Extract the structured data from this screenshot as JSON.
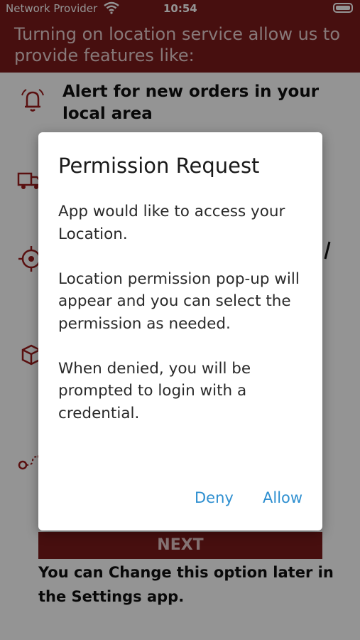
{
  "status_bar": {
    "carrier": "Network Provider",
    "time": "10:54",
    "wifi_icon": "wifi-icon",
    "battery_icon": "battery-full-icon"
  },
  "header": {
    "text": "Turning on location service allow us to provide features like:"
  },
  "features": [
    {
      "icon": "bell-icon",
      "label": "Alert for new orders in your local area"
    },
    {
      "icon": "delivery-truck-icon",
      "label": ""
    },
    {
      "icon": "location-target-icon",
      "label": ""
    },
    {
      "icon": "package-icon",
      "label": ""
    },
    {
      "icon": "route-icon",
      "label": ""
    }
  ],
  "next_button": {
    "label": "NEXT"
  },
  "footer_note": "You can Change this option later in\nthe Settings app.",
  "dialog": {
    "title": "Permission Request",
    "paragraphs": [
      "App would like to access your Location.",
      "Location permission pop-up will appear and you can select the permission as needed.",
      "When denied, you will be prompted to login with a credential."
    ],
    "deny_label": "Deny",
    "allow_label": "Allow"
  },
  "colors": {
    "brand": "#7a1a1a",
    "link": "#2e8fd0"
  }
}
